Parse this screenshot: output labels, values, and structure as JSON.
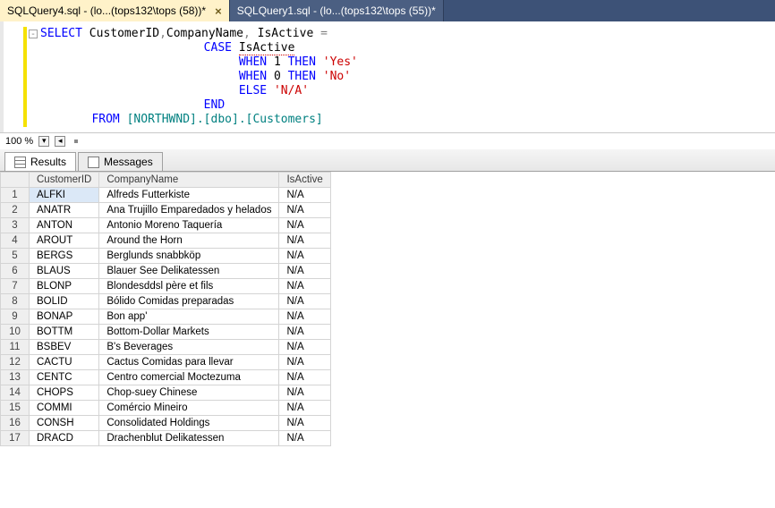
{
  "tabs": [
    {
      "label": "SQLQuery4.sql - (lo...(tops132\\tops (58))*",
      "active": true
    },
    {
      "label": "SQLQuery1.sql - (lo...(tops132\\tops (55))*",
      "active": false
    }
  ],
  "code": {
    "l1a": "SELECT",
    "l1b": "CustomerID",
    "l1c": "CompanyName",
    "l1d": "IsActive",
    "eq": "=",
    "case": "CASE",
    "isactive2": "IsActive",
    "when": "WHEN",
    "then": "THEN",
    "else": "ELSE",
    "end": "END",
    "one": "1",
    "zero": "0",
    "yes": "'Yes'",
    "no": "'No'",
    "na": "'N/A'",
    "from": "FROM",
    "tbl": "[NORTHWND].[dbo].[Customers]"
  },
  "zoom": {
    "value": "100 %"
  },
  "resultTabs": {
    "results": "Results",
    "messages": "Messages"
  },
  "columns": {
    "c1": "CustomerID",
    "c2": "CompanyName",
    "c3": "IsActive"
  },
  "rows": [
    {
      "n": "1",
      "id": "ALFKI",
      "co": "Alfreds Futterkiste",
      "a": "N/A"
    },
    {
      "n": "2",
      "id": "ANATR",
      "co": "Ana Trujillo Emparedados y helados",
      "a": "N/A"
    },
    {
      "n": "3",
      "id": "ANTON",
      "co": "Antonio Moreno Taquería",
      "a": "N/A"
    },
    {
      "n": "4",
      "id": "AROUT",
      "co": "Around the Horn",
      "a": "N/A"
    },
    {
      "n": "5",
      "id": "BERGS",
      "co": "Berglunds snabbköp",
      "a": "N/A"
    },
    {
      "n": "6",
      "id": "BLAUS",
      "co": "Blauer See Delikatessen",
      "a": "N/A"
    },
    {
      "n": "7",
      "id": "BLONP",
      "co": "Blondesddsl père et fils",
      "a": "N/A"
    },
    {
      "n": "8",
      "id": "BOLID",
      "co": "Bólido Comidas preparadas",
      "a": "N/A"
    },
    {
      "n": "9",
      "id": "BONAP",
      "co": "Bon app'",
      "a": "N/A"
    },
    {
      "n": "10",
      "id": "BOTTM",
      "co": "Bottom-Dollar Markets",
      "a": "N/A"
    },
    {
      "n": "11",
      "id": "BSBEV",
      "co": "B's Beverages",
      "a": "N/A"
    },
    {
      "n": "12",
      "id": "CACTU",
      "co": "Cactus Comidas para llevar",
      "a": "N/A"
    },
    {
      "n": "13",
      "id": "CENTC",
      "co": "Centro comercial Moctezuma",
      "a": "N/A"
    },
    {
      "n": "14",
      "id": "CHOPS",
      "co": "Chop-suey Chinese",
      "a": "N/A"
    },
    {
      "n": "15",
      "id": "COMMI",
      "co": "Comércio Mineiro",
      "a": "N/A"
    },
    {
      "n": "16",
      "id": "CONSH",
      "co": "Consolidated Holdings",
      "a": "N/A"
    },
    {
      "n": "17",
      "id": "DRACD",
      "co": "Drachenblut Delikatessen",
      "a": "N/A"
    }
  ]
}
